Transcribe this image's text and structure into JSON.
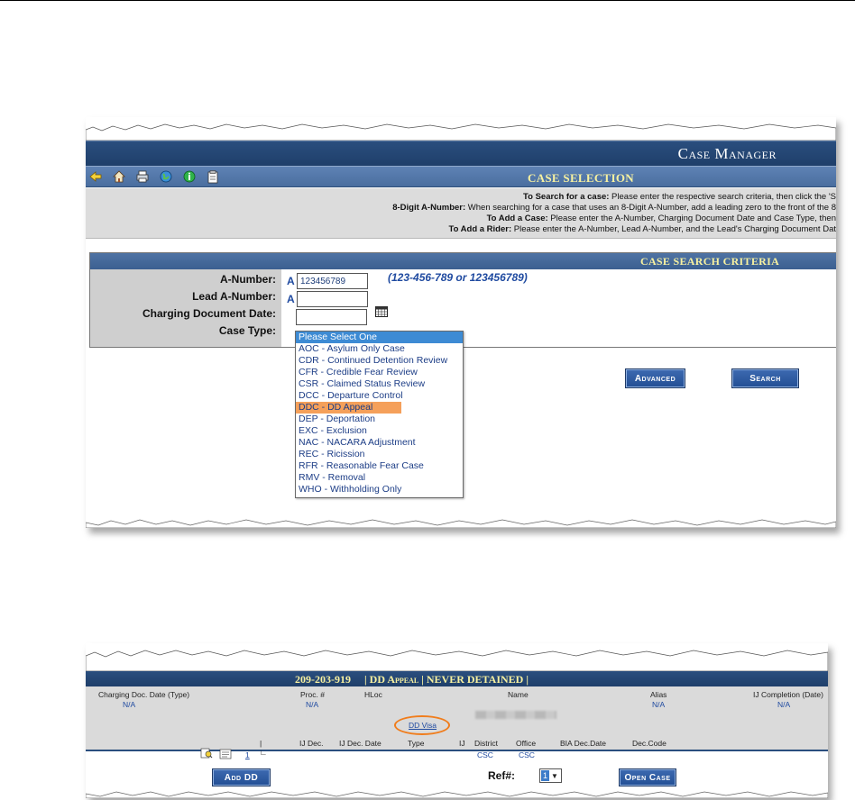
{
  "app": {
    "title": "Case Manager"
  },
  "toolbar": {
    "icons": [
      "back-arrow-icon",
      "home-icon",
      "print-icon",
      "globe-icon",
      "info-icon",
      "clipboard-icon"
    ]
  },
  "case_selection": {
    "title": "CASE SELECTION",
    "help": [
      {
        "label": "To Search for a case:",
        "text": " Please enter the respective search criteria, then click the 'S"
      },
      {
        "label": "8-Digit A-Number:",
        "text": " When searching for a case that uses an 8-Digit A-Number, add a leading zero to the front of the 8"
      },
      {
        "label": "To Add a Case:",
        "text": " Please enter the A-Number, Charging Document Date and Case Type, then"
      },
      {
        "label": "To Add a Rider:",
        "text": " Please enter the A-Number, Lead A-Number, and the Lead's Charging Document Dat"
      }
    ]
  },
  "criteria": {
    "title": "CASE SEARCH CRITERIA",
    "a_number_label": "A-Number:",
    "lead_a_number_label": "Lead A-Number:",
    "charging_date_label": "Charging Document Date:",
    "case_type_label": "Case Type:",
    "a_prefix": "A",
    "a_number_value": "123456789",
    "lead_a_number_value": "",
    "charging_date_value": "",
    "format_hint": "(123-456-789 or 123456789)"
  },
  "buttons": {
    "advanced": "Advanced",
    "search": "Search"
  },
  "case_type_dropdown": {
    "placeholder": "Please Select One",
    "highlighted": "DDC - DD Appeal",
    "options": [
      "AOC - Asylum Only Case",
      "CDR - Continued Detention Review",
      "CFR - Credible Fear Review",
      "CSR - Claimed Status Review",
      "DCC - Departure Control",
      "DDC - DD Appeal",
      "DEP - Deportation",
      "EXC - Exclusion",
      "NAC - NACARA Adjustment",
      "REC - Ricission",
      "RFR - Reasonable Fear Case",
      "RMV - Removal",
      "WHO - Withholding Only"
    ]
  },
  "case_detail": {
    "a_number": "209-203-919",
    "sep": "|",
    "case_type": "DD Appeal",
    "detention": "NEVER DETAINED",
    "headers": {
      "charging_doc_date": "Charging Doc. Date (Type)",
      "proc": "Proc. #",
      "hloc": "HLoc",
      "name": "Name",
      "alias": "Alias",
      "ij_completion": "IJ Completion (Date)",
      "ij_dec": "IJ Dec.",
      "ij_dec_date": "IJ Dec. Date",
      "type": "Type",
      "ij": "IJ",
      "district": "District",
      "office": "Office",
      "bia_dec_date": "BIA Dec.Date",
      "dec_code": "Dec.Code"
    },
    "values": {
      "charging_doc_date": "N/A",
      "proc": "N/A",
      "alias": "N/A",
      "ij_completion": "N/A",
      "row_number": "1",
      "type": "DD Visa",
      "district": "CSC",
      "office": "CSC"
    },
    "buttons": {
      "add_dd": "Add DD",
      "open_case": "Open Case"
    },
    "ref_label": "Ref#:",
    "ref_value": "1"
  },
  "colors": {
    "header_navy": "#1f3f6a",
    "title_yellow": "#f7f1a0",
    "link_blue": "#1f4aa0",
    "highlight_orange": "#f5a05a",
    "dropdown_selected": "#3d8bd4"
  }
}
